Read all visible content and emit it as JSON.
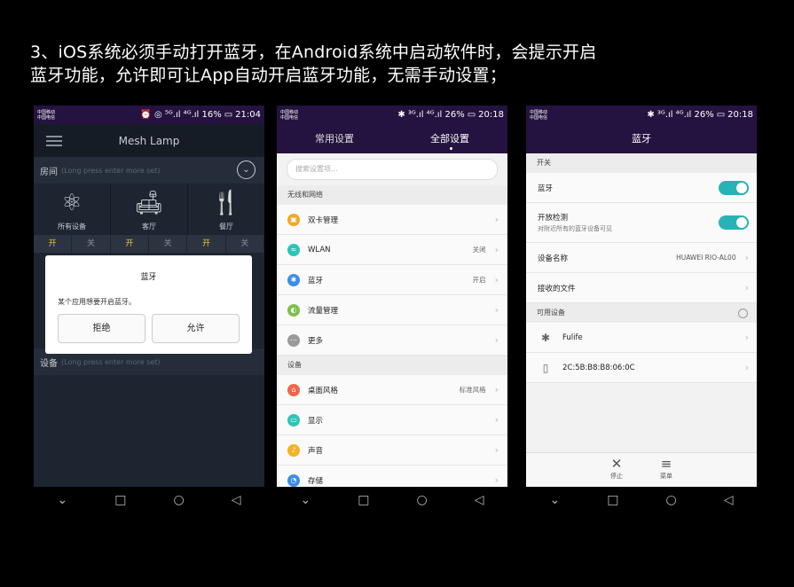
{
  "caption": {
    "line1": "3、iOS系统必须手动打开蓝牙，在Android系统中启动软件时，会提示开启",
    "line2": "蓝牙功能，允许即可让App自动开启蓝牙功能，无需手动设置；"
  },
  "phone1": {
    "status_left1": "中国移动",
    "status_left2": "中国电信",
    "status_right": "⏰ ◎ ⁵ᴳ.ıl ⁴ᴳ.ıl 16%",
    "time": "21:04",
    "title": "Mesh Lamp",
    "section_room": "房间",
    "section_room_hint": "(Long press enter more set)",
    "rooms": [
      {
        "label": "所有设备",
        "icon": "⚛"
      },
      {
        "label": "客厅",
        "icon": "🛋"
      },
      {
        "label": "餐厅",
        "icon": "🍴"
      }
    ],
    "on_label": "开",
    "off_label": "关",
    "dialog_title": "蓝牙",
    "dialog_message": "某个应用想要开启蓝牙。",
    "deny_label": "拒绝",
    "allow_label": "允许",
    "section_device": "设备",
    "section_device_hint": "(Long press enter more set)"
  },
  "phone2": {
    "status_left1": "中国移动",
    "status_left2": "中国电信",
    "status_right": "✱ ³ᴳ.ıl ⁴ᴳ.ıl 26%",
    "time": "20:18",
    "tab_common": "常用设置",
    "tab_all": "全部设置",
    "search_placeholder": "搜索设置项...",
    "group_network": "无线和网络",
    "network_items": [
      {
        "label": "双卡管理",
        "value": "",
        "color": "#f5a623",
        "icon": "▣"
      },
      {
        "label": "WLAN",
        "value": "关闭",
        "color": "#2ec4b6",
        "icon": "≈"
      },
      {
        "label": "蓝牙",
        "value": "开启",
        "color": "#3a8ee6",
        "icon": "✱"
      },
      {
        "label": "流量管理",
        "value": "",
        "color": "#7cc04b",
        "icon": "◐"
      },
      {
        "label": "更多",
        "value": "",
        "color": "#9a9a9a",
        "icon": "⋯"
      }
    ],
    "group_device": "设备",
    "device_items": [
      {
        "label": "桌面风格",
        "value": "标准风格",
        "color": "#f0654a",
        "icon": "⌂"
      },
      {
        "label": "显示",
        "value": "",
        "color": "#2ec4b6",
        "icon": "▭"
      },
      {
        "label": "声音",
        "value": "",
        "color": "#f5b323",
        "icon": "♪"
      },
      {
        "label": "存储",
        "value": "",
        "color": "#3a8ee6",
        "icon": "◔"
      }
    ]
  },
  "phone3": {
    "status_left1": "中国移动",
    "status_left2": "中国电信",
    "status_right": "✱ ³ᴳ.ıl ⁴ᴳ.ıl 26%",
    "time": "20:18",
    "title": "蓝牙",
    "group_switch": "开关",
    "bluetooth_label": "蓝牙",
    "discover_label": "开放检测",
    "discover_sub": "对附近所有的蓝牙设备可见",
    "device_name_label": "设备名称",
    "device_name_value": "HUAWEI RIO-AL00",
    "received_files_label": "接收的文件",
    "group_available": "可用设备",
    "available_devices": [
      {
        "name": "Fulife",
        "icon": "✱"
      },
      {
        "name": "2C:5B:B8:B8:06:0C",
        "icon": "▯"
      }
    ],
    "stop_label": "停止",
    "menu_label": "菜单"
  },
  "nav": {
    "back": "◁",
    "home": "○",
    "recent": "□",
    "down": "⌄"
  }
}
